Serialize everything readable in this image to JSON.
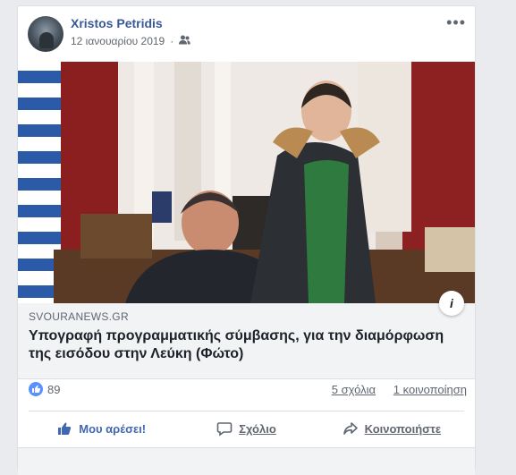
{
  "post": {
    "author": "Xristos Petridis",
    "date": "12 ιανουαρίου 2019",
    "audience_icon": "friends-icon",
    "more_icon": "ellipsis-icon"
  },
  "link": {
    "domain": "SVOURANEWS.GR",
    "headline": "Υπογραφή προγραμματικής σύμβασης, για την διαμόρφωση της εισόδου στην Λεύκη (Φώτο)"
  },
  "stats": {
    "likes": "89",
    "comments": "5 σχόλια",
    "shares": "1 κοινοποίηση"
  },
  "actions": {
    "like": "Μου αρέσει!",
    "comment": "Σχόλιο",
    "share": "Κοινοποιήστε"
  },
  "colors": {
    "link_blue": "#385898",
    "like_blue": "#4267b2",
    "muted": "#606770"
  }
}
